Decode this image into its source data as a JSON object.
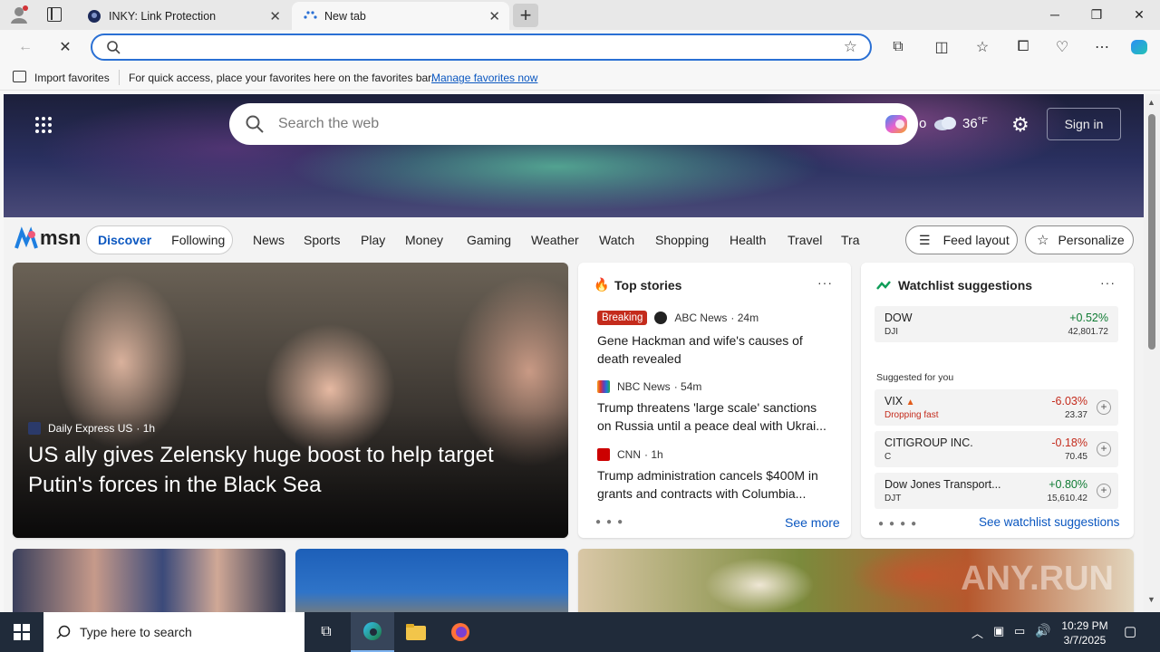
{
  "tabs": [
    {
      "title": "INKY: Link Protection"
    },
    {
      "title": "New tab"
    }
  ],
  "address_bar": {
    "value": ""
  },
  "favorites_bar": {
    "import_label": "Import favorites",
    "hint": "For quick access, place your favorites here on the favorites bar.",
    "manage_link": "Manage favorites now"
  },
  "msn": {
    "search_placeholder": "Search the web",
    "weather_temp": "36",
    "weather_unit": "°F",
    "weather_clip": "o",
    "sign_in": "Sign in",
    "logo": "msn",
    "tabs": [
      "Discover",
      "Following"
    ],
    "nav": [
      "News",
      "Sports",
      "Play",
      "Money",
      "Gaming",
      "Weather",
      "Watch",
      "Shopping",
      "Health",
      "Travel",
      "Tra"
    ],
    "feed_layout": "Feed layout",
    "personalize": "Personalize"
  },
  "main_story": {
    "source": "Daily Express US",
    "age": "· 1h",
    "headline": "US ally gives Zelensky huge boost to help target Putin's forces in the Black Sea"
  },
  "top_stories": {
    "title": "Top stories",
    "items": [
      {
        "badge": "Breaking",
        "source": "ABC News",
        "age": "· 24m",
        "title": "Gene Hackman and wife's causes of death revealed"
      },
      {
        "badge": "",
        "source": "NBC News",
        "age": "· 54m",
        "title": "Trump threatens 'large scale' sanctions on Russia until a peace deal with Ukrai..."
      },
      {
        "badge": "",
        "source": "CNN",
        "age": "· 1h",
        "title": "Trump administration cancels $400M in grants and contracts with Columbia..."
      }
    ],
    "see_more": "See more"
  },
  "watchlist": {
    "title": "Watchlist suggestions",
    "pinned": {
      "symbol": "DOW",
      "sub": "DJI",
      "pct": "+0.52%",
      "value": "42,801.72"
    },
    "suggested_label": "Suggested for you",
    "suggestions": [
      {
        "symbol": "VIX",
        "sub": "Dropping fast",
        "pct": "-6.03%",
        "value": "23.37",
        "dir": "neg"
      },
      {
        "symbol": "CITIGROUP INC.",
        "sub": "C",
        "pct": "-0.18%",
        "value": "70.45",
        "dir": "neg"
      },
      {
        "symbol": "Dow Jones Transport...",
        "sub": "DJT",
        "pct": "+0.80%",
        "value": "15,610.42",
        "dir": "pos"
      }
    ],
    "see_link": "See watchlist suggestions"
  },
  "taskbar": {
    "search_placeholder": "Type here to search",
    "time": "10:29 PM",
    "date": "3/7/2025"
  },
  "watermark": "ANY.RUN",
  "colors": {
    "accent": "#0b57c0",
    "breaking": "#c42b1c",
    "positive": "#0f7b33",
    "negative": "#c42b1c"
  }
}
